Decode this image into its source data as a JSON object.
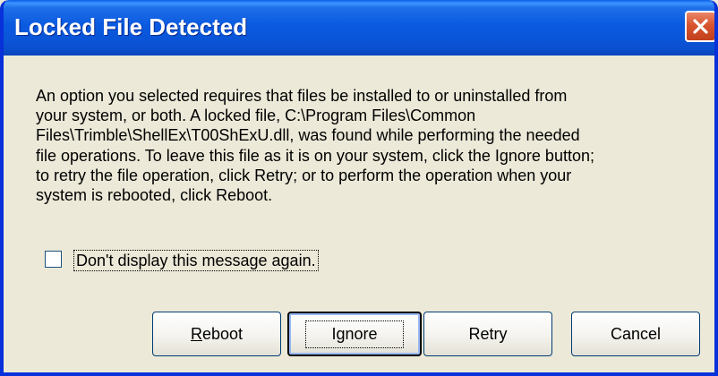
{
  "window": {
    "title": "Locked File Detected"
  },
  "message": {
    "lines": [
      "An option you selected requires that files be installed to or uninstalled from",
      "your system, or both. A locked file, C:\\Program Files\\Common",
      "Files\\Trimble\\ShellEx\\T00ShExU.dll, was found while performing the needed",
      "file operations. To leave this file as it is on your system, click the Ignore button;",
      "to retry the file operation, click Retry; or to perform the operation when your",
      "system is rebooted, click Reboot."
    ]
  },
  "checkbox": {
    "label": "Don't display this message again.",
    "checked": false
  },
  "buttons": {
    "reboot": "Reboot",
    "ignore": "Ignore",
    "retry": "Retry",
    "cancel": "Cancel"
  },
  "icons": {
    "close": "close-icon"
  },
  "colors": {
    "titlebar": "#0A5AE0",
    "close_button": "#D8542F",
    "dialog_bg": "#ECE9D8"
  }
}
